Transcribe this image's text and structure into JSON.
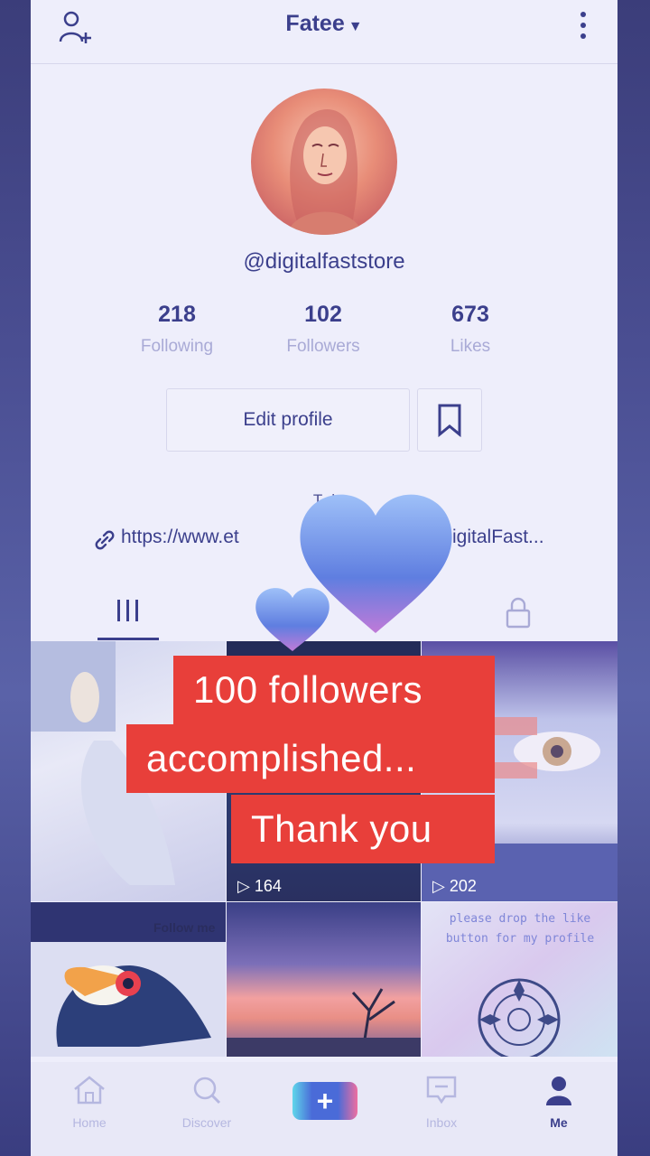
{
  "header": {
    "title": "Fatee"
  },
  "profile": {
    "handle": "@digitalfaststore",
    "stats": [
      {
        "value": "218",
        "label": "Following"
      },
      {
        "value": "102",
        "label": "Followers"
      },
      {
        "value": "673",
        "label": "Likes"
      }
    ],
    "edit_label": "Edit profile",
    "bio_visible": "T            d",
    "link_start": "https://www.et",
    "link_end": "/DigitalFast..."
  },
  "videos": [
    {
      "views": ""
    },
    {
      "views": "164"
    },
    {
      "views": "202"
    },
    {
      "caption": "Follow me"
    },
    {
      "views": ""
    },
    {
      "caption": "please drop the like button for my profile"
    }
  ],
  "overlay": {
    "line1": "100 followers",
    "line2": "accomplished...",
    "line3": "Thank you"
  },
  "nav": [
    {
      "label": "Home"
    },
    {
      "label": "Discover"
    },
    {
      "label": ""
    },
    {
      "label": "Inbox"
    },
    {
      "label": "Me"
    }
  ],
  "colors": {
    "accent": "#3b3f8c",
    "overlay_red": "#e83f3a"
  }
}
